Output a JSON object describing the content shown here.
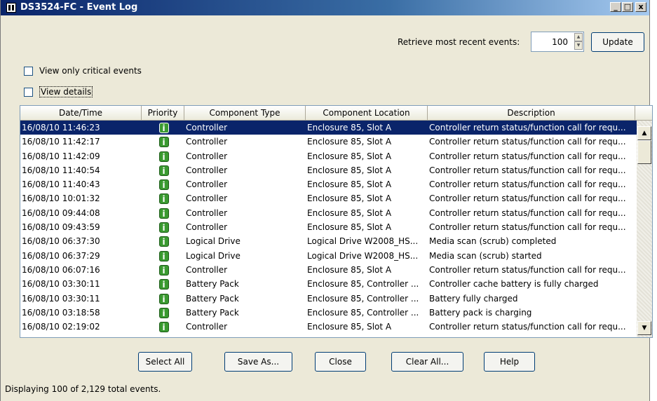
{
  "window": {
    "title": "DS3524-FC - Event Log",
    "minimize": "_",
    "maximize": "□",
    "close": "x"
  },
  "retrieve": {
    "label": "Retrieve most recent events:",
    "value": "100",
    "update_label": "Update"
  },
  "options": {
    "critical_label": "View only critical events",
    "details_label": "View details"
  },
  "table": {
    "columns": [
      "Date/Time",
      "Priority",
      "Component Type",
      "Component Location",
      "Description"
    ],
    "rows": [
      {
        "date": "16/08/10 11:46:23",
        "type": "Controller",
        "location": "Enclosure 85, Slot A",
        "desc": "Controller return status/function call for requ..."
      },
      {
        "date": "16/08/10 11:42:17",
        "type": "Controller",
        "location": "Enclosure 85, Slot A",
        "desc": "Controller return status/function call for requ..."
      },
      {
        "date": "16/08/10 11:42:09",
        "type": "Controller",
        "location": "Enclosure 85, Slot A",
        "desc": "Controller return status/function call for requ..."
      },
      {
        "date": "16/08/10 11:40:54",
        "type": "Controller",
        "location": "Enclosure 85, Slot A",
        "desc": "Controller return status/function call for requ..."
      },
      {
        "date": "16/08/10 11:40:43",
        "type": "Controller",
        "location": "Enclosure 85, Slot A",
        "desc": "Controller return status/function call for requ..."
      },
      {
        "date": "16/08/10 10:01:32",
        "type": "Controller",
        "location": "Enclosure 85, Slot A",
        "desc": "Controller return status/function call for requ..."
      },
      {
        "date": "16/08/10 09:44:08",
        "type": "Controller",
        "location": "Enclosure 85, Slot A",
        "desc": "Controller return status/function call for requ..."
      },
      {
        "date": "16/08/10 09:43:59",
        "type": "Controller",
        "location": "Enclosure 85, Slot A",
        "desc": "Controller return status/function call for requ..."
      },
      {
        "date": "16/08/10 06:37:30",
        "type": "Logical Drive",
        "location": "Logical Drive W2008_HS...",
        "desc": "Media scan (scrub) completed"
      },
      {
        "date": "16/08/10 06:37:29",
        "type": "Logical Drive",
        "location": "Logical Drive W2008_HS...",
        "desc": "Media scan (scrub) started"
      },
      {
        "date": "16/08/10 06:07:16",
        "type": "Controller",
        "location": "Enclosure 85, Slot A",
        "desc": "Controller return status/function call for requ..."
      },
      {
        "date": "16/08/10 03:30:11",
        "type": "Battery Pack",
        "location": "Enclosure 85, Controller ...",
        "desc": "Controller cache battery is fully charged"
      },
      {
        "date": "16/08/10 03:30:11",
        "type": "Battery Pack",
        "location": "Enclosure 85, Controller ...",
        "desc": "Battery fully charged"
      },
      {
        "date": "16/08/10 03:18:58",
        "type": "Battery Pack",
        "location": "Enclosure 85, Controller ...",
        "desc": "Battery pack is charging"
      },
      {
        "date": "16/08/10 02:19:02",
        "type": "Controller",
        "location": "Enclosure 85, Slot A",
        "desc": "Controller return status/function call for requ..."
      }
    ],
    "priority_icon": "info-icon",
    "priority_glyph": "i"
  },
  "buttons": {
    "select_all": "Select All",
    "save_as": "Save As...",
    "close": "Close",
    "clear_all": "Clear All...",
    "help": "Help"
  },
  "status": "Displaying 100 of 2,129 total events.",
  "colors": {
    "selection": "#0a246a",
    "info_icon": "#3a9a30"
  }
}
